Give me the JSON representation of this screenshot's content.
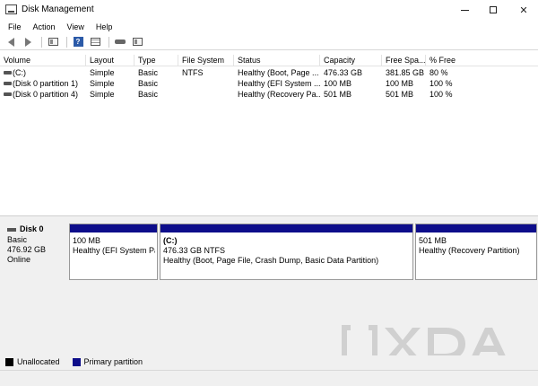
{
  "window": {
    "title": "Disk Management"
  },
  "menu": [
    "File",
    "Action",
    "View",
    "Help"
  ],
  "toolbar_icons": [
    "back-arrow-icon",
    "forward-arrow-icon",
    "properties-icon",
    "help-icon",
    "details-icon",
    "rescan-icon",
    "list-icon"
  ],
  "volumes": {
    "columns": [
      "Volume",
      "Layout",
      "Type",
      "File System",
      "Status",
      "Capacity",
      "Free Spa...",
      "% Free"
    ],
    "rows": [
      [
        "(C:)",
        "Simple",
        "Basic",
        "NTFS",
        "Healthy (Boot, Page ...",
        "476.33 GB",
        "381.85 GB",
        "80 %"
      ],
      [
        "(Disk 0 partition 1)",
        "Simple",
        "Basic",
        "",
        "Healthy (EFI System ...",
        "100 MB",
        "100 MB",
        "100 %"
      ],
      [
        "(Disk 0 partition 4)",
        "Simple",
        "Basic",
        "",
        "Healthy (Recovery Pa...",
        "501 MB",
        "501 MB",
        "100 %"
      ]
    ]
  },
  "disk": {
    "name": "Disk 0",
    "type": "Basic",
    "size": "476.92 GB",
    "state": "Online",
    "partitions": [
      {
        "name": "",
        "size": "100 MB",
        "status": "Healthy (EFI System Par"
      },
      {
        "name": "(C:)",
        "size": "476.33 GB NTFS",
        "status": "Healthy (Boot, Page File, Crash Dump, Basic Data Partition)"
      },
      {
        "name": "",
        "size": "501 MB",
        "status": "Healthy (Recovery Partition)"
      }
    ]
  },
  "legend": [
    {
      "label": "Unallocated",
      "color": "#000000"
    },
    {
      "label": "Primary partition",
      "color": "#0d0d8a"
    }
  ],
  "watermark": "XDA",
  "colors": {
    "primary_partition": "#0d0d8a",
    "unallocated": "#000000"
  }
}
